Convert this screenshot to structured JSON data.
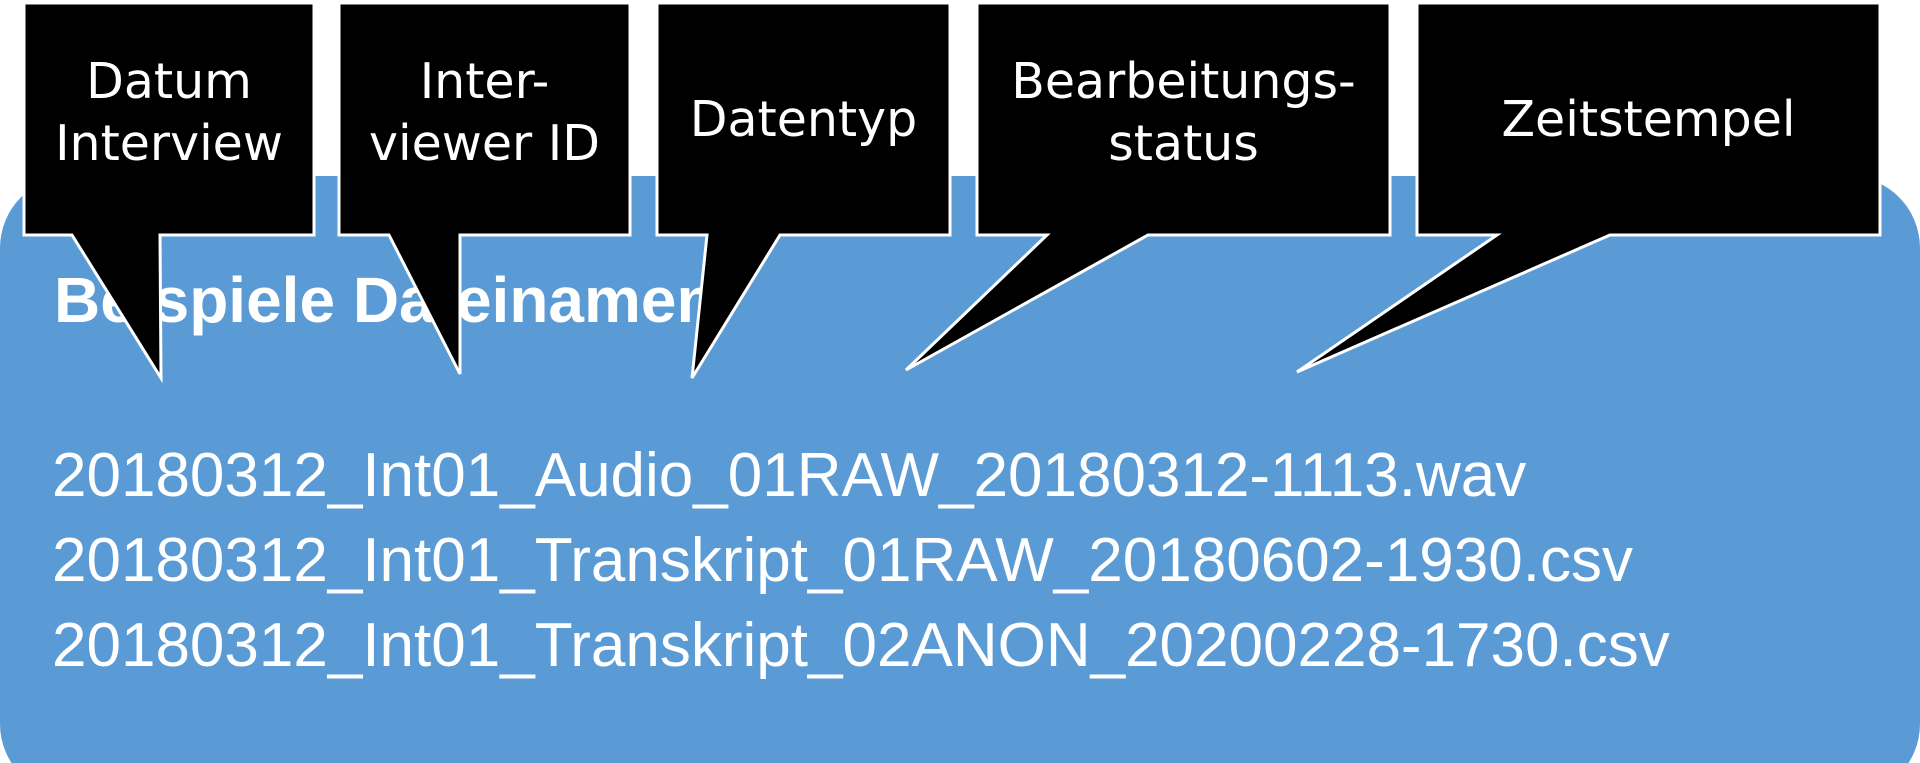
{
  "colors": {
    "panel": "#5b9bd5",
    "callout_fill": "#000000",
    "callout_stroke": "#ffffff",
    "text": "#ffffff"
  },
  "panel": {
    "title": "Beispiele Dateinamen",
    "files": [
      "20180312_Int01_Audio_01RAW_20180312-1113.wav",
      "20180312_Int01_Transkript_01RAW_20180602-1930.csv",
      "20180312_Int01_Transkript_02ANON_20200228-1730.csv"
    ]
  },
  "callouts": [
    {
      "label": "Datum\nInterview"
    },
    {
      "label": "Inter-\nviewer ID"
    },
    {
      "label": "Datentyp"
    },
    {
      "label": "Bearbeitungs-\nstatus"
    },
    {
      "label": "Zeitstempel"
    }
  ]
}
